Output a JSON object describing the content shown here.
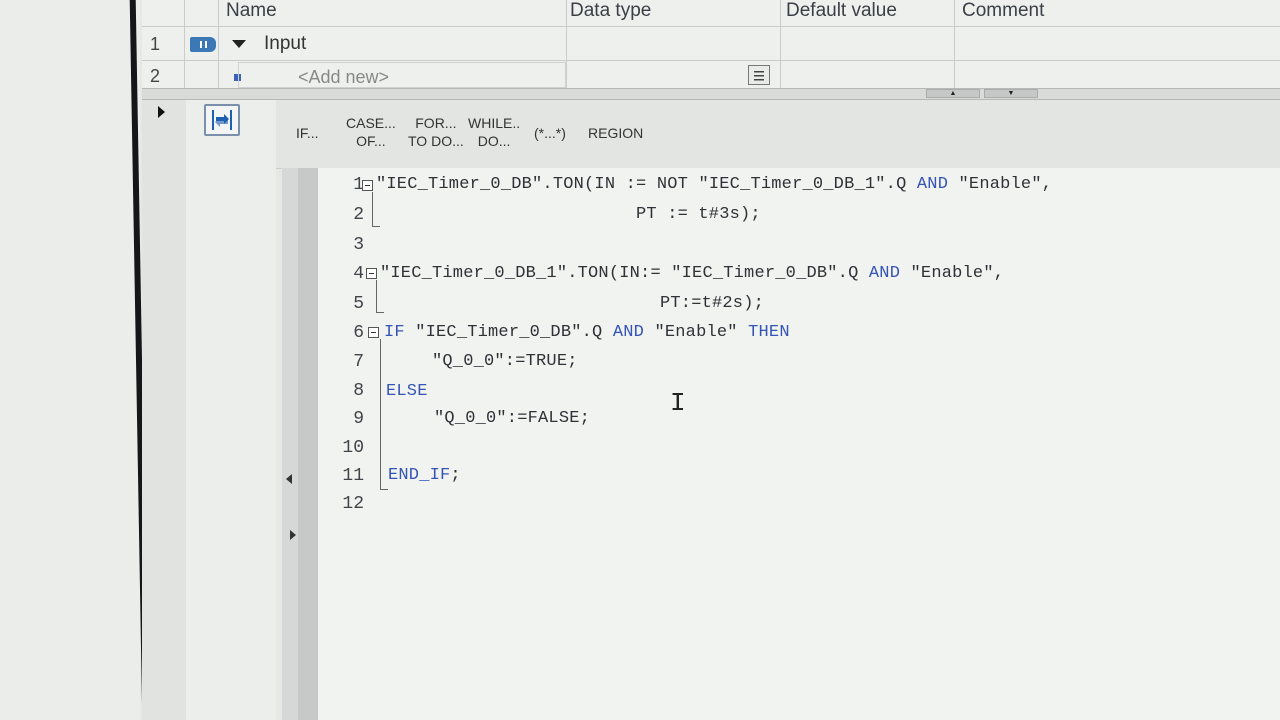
{
  "interface": {
    "columns": [
      "Name",
      "Data type",
      "Default value",
      "Comment"
    ],
    "rows": [
      {
        "num": "1",
        "name": "Input"
      },
      {
        "num": "2",
        "name": "<Add new>"
      }
    ]
  },
  "toolbar": {
    "items": [
      {
        "line1": "IF...",
        "line2": ""
      },
      {
        "line1": "CASE...",
        "line2": "OF..."
      },
      {
        "line1": "FOR...",
        "line2": "TO DO..."
      },
      {
        "line1": "WHILE..",
        "line2": "DO..."
      },
      {
        "line1": "(*...*)",
        "line2": ""
      },
      {
        "line1": "REGION",
        "line2": ""
      }
    ]
  },
  "code": {
    "line_numbers": [
      "1",
      "2",
      "3",
      "4",
      "5",
      "6",
      "7",
      "8",
      "9",
      "10",
      "11",
      "12"
    ],
    "l1a": "\"IEC_Timer_0_DB\".TON(IN := NOT \"IEC_Timer_0_DB_1\".Q ",
    "l1kw": "AND",
    "l1b": " \"Enable\",",
    "l2": "PT := t#3s);",
    "l4a": "\"IEC_Timer_0_DB_1\".TON(IN:= \"IEC_Timer_0_DB\".Q ",
    "l4kw": "AND",
    "l4b": " \"Enable\",",
    "l5": "PT:=t#2s);",
    "l6kw1": "IF",
    "l6a": " \"IEC_Timer_0_DB\".Q ",
    "l6kw2": "AND",
    "l6b": " \"Enable\" ",
    "l6kw3": "THEN",
    "l7": "\"Q_0_0\":=TRUE;",
    "l8kw": "ELSE",
    "l9": "\"Q_0_0\":=FALSE;",
    "l11kw": "END_IF",
    "l11b": ";"
  },
  "colors": {
    "keyword": "#3554b5",
    "text": "#2e3236"
  }
}
